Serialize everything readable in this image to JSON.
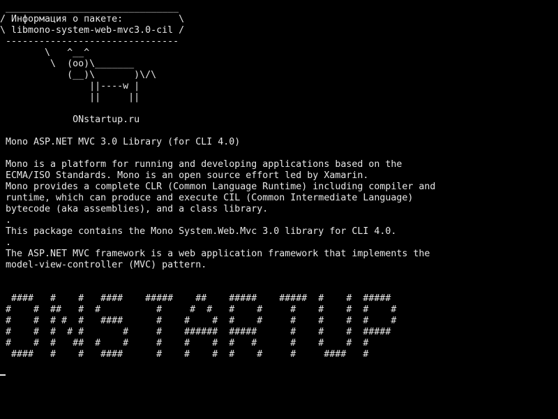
{
  "terminal": {
    "lines": [
      " _______________________________",
      "/ Информация о пакете:          \\",
      "\\ libmono-system-web-mvc3.0-cil /",
      " -------------------------------",
      "        \\   ^__^",
      "         \\  (oo)\\_______",
      "            (__)\\       )\\/\\",
      "                ||----w |",
      "                ||     ||",
      "",
      "             ONstartup.ru",
      "",
      " Mono ASP.NET MVC 3.0 Library (for CLI 4.0)",
      "",
      " Mono is a platform for running and developing applications based on the",
      " ECMA/ISO Standards. Mono is an open source effort led by Xamarin.",
      " Mono provides a complete CLR (Common Language Runtime) including compiler and",
      " runtime, which can produce and execute CIL (Common Intermediate Language)",
      " bytecode (aka assemblies), and a class library.",
      " .",
      " This package contains the Mono System.Web.Mvc 3.0 library for CLI 4.0.",
      " .",
      " The ASP.NET MVC framework is a web application framework that implements the",
      " model-view-controller (MVC) pattern.",
      "",
      "",
      "  ####   #    #   ####    #####    ##    #####    #####  #    #  #####",
      " #    #  ##   #  #          #     #  #   #    #     #    #    #  #    #",
      " #    #  # #  #   ####      #    #    #  #    #     #    #    #  #    #",
      " #    #  #  # #       #     #    ######  #####      #    #    #  #####",
      " #    #  #   ##  #    #     #    #    #  #   #      #    #    #  #",
      "  ####   #    #   ####      #    #    #  #    #     #     ####   #"
    ]
  }
}
